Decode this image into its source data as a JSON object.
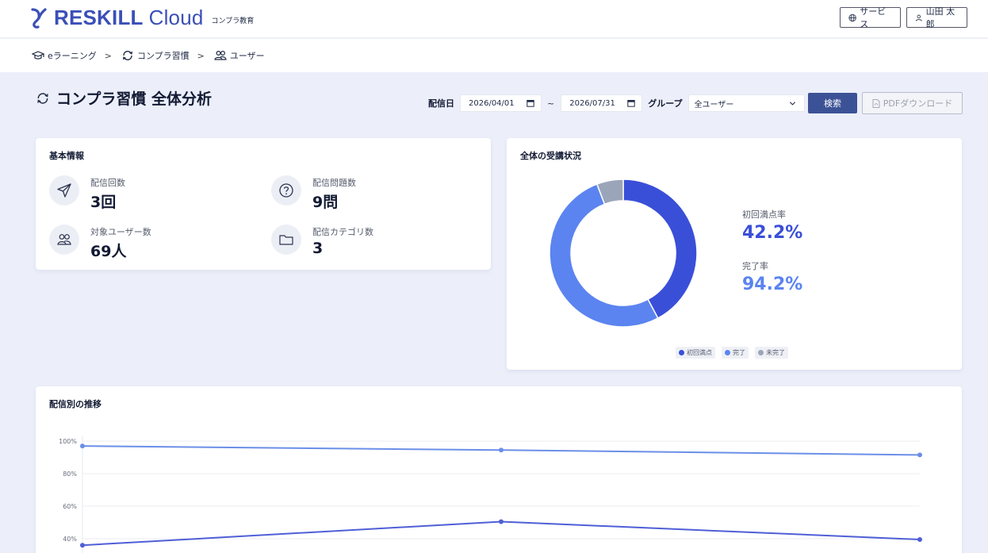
{
  "header": {
    "logo_main": "RESKILL",
    "logo_light": "Cloud",
    "logo_sub": "コンプラ教育",
    "service_label": "サービス",
    "user_label": "山田 太郎"
  },
  "breadcrumb": {
    "items": [
      "eラーニング",
      "コンプラ習慣",
      "ユーザー"
    ],
    "separator": ">"
  },
  "page": {
    "title": "コンプラ習慣 全体分析"
  },
  "filter": {
    "date_label": "配信日",
    "date_from": "2026/04/01",
    "date_sep": "~",
    "date_to": "2026/07/31",
    "group_label": "グループ",
    "group_value": "全ユーザー",
    "search_label": "検索",
    "pdf_label": "PDFダウンロード"
  },
  "basic_info": {
    "title": "基本情報",
    "stats": [
      {
        "label": "配信回数",
        "value": "3回",
        "icon": "paper-plane-icon"
      },
      {
        "label": "配信問題数",
        "value": "9問",
        "icon": "question-circle-icon"
      },
      {
        "label": "対象ユーザー数",
        "value": "69人",
        "icon": "users-icon"
      },
      {
        "label": "配信カテゴリ数",
        "value": "3",
        "icon": "folder-icon"
      }
    ]
  },
  "overall_status": {
    "title": "全体の受講状況",
    "first_pass_label": "初回満点率",
    "first_pass_value": "42.2%",
    "completion_label": "完了率",
    "completion_value": "94.2%",
    "legend": [
      "初回満点",
      "完了",
      "未完了"
    ]
  },
  "trend": {
    "title": "配信別の推移"
  },
  "colors": {
    "accent": "#3b4fb8",
    "first_pass": "#3a4fd8",
    "complete": "#5b84f0",
    "incomplete": "#9ba5b9",
    "button": "#3c5296"
  },
  "chart_data": [
    {
      "type": "pie",
      "donut": true,
      "labels": [
        "初回満点",
        "完了",
        "未完了"
      ],
      "values": [
        42.2,
        52.0,
        5.8
      ]
    },
    {
      "type": "line",
      "x": [
        1,
        2,
        3
      ],
      "ylim": [
        30,
        100
      ],
      "y_ticks": [
        "40%",
        "60%",
        "80%",
        "100%"
      ],
      "grid": true,
      "series": [
        {
          "values": [
            97,
            94.5,
            91.5
          ]
        },
        {
          "values": [
            36,
            50.5,
            39.5
          ]
        }
      ]
    }
  ]
}
